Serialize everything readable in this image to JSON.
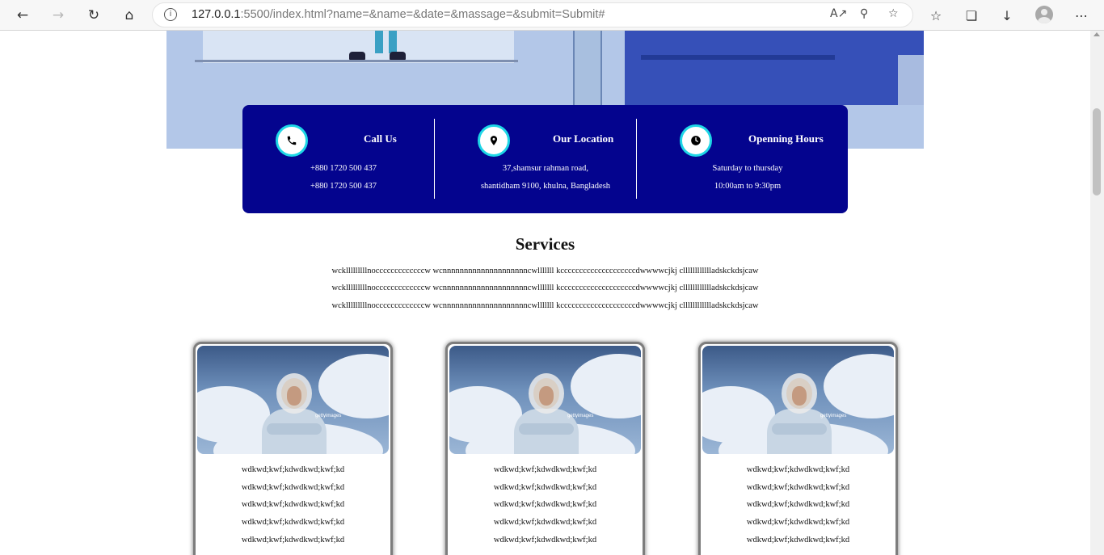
{
  "browser": {
    "url_host": "127.0.0.1",
    "url_rest": ":5500/index.html?name=&name=&date=&massage=&submit=Submit#",
    "icons": [
      "back-icon",
      "forward-icon",
      "refresh-icon",
      "home-icon",
      "info-icon",
      "read-aloud-icon",
      "zoom-icon",
      "add-favorite-icon",
      "favorites-icon",
      "collections-icon",
      "downloads-icon",
      "profile-icon",
      "more-icon"
    ]
  },
  "contact": {
    "call": {
      "title": "Call Us",
      "line1": "+880 1720 500 437",
      "line2": "+880 1720 500 437"
    },
    "location": {
      "title": "Our Location",
      "line1": "37,shamsur rahman road,",
      "line2": "shantidham 9100, khulna, Bangladesh"
    },
    "hours": {
      "title": "Openning Hours",
      "line1": "Saturday to thursday",
      "line2": "10:00am to 9:30pm"
    }
  },
  "services": {
    "title": "Services",
    "lines": [
      "wcklllllllllnocccccccccccccw wcnnnnnnnnnnnnnnnnnnnncwlllllll kccccccccccccccccccccdwwwwcjkj clllllllllllladskckdsjcaw",
      "wcklllllllllnocccccccccccccw wcnnnnnnnnnnnnnnnnnnnncwlllllll kccccccccccccccccccccdwwwwcjkj clllllllllllladskckdsjcaw",
      "wcklllllllllnocccccccccccccw wcnnnnnnnnnnnnnnnnnnnncwlllllll kccccccccccccccccccccdwwwwcjkj clllllllllllladskckdsjcaw"
    ]
  },
  "cards": [
    {
      "photo_watermark": "gettyimages",
      "lines": [
        "wdkwd;kwf;kdwdkwd;kwf;kd",
        "wdkwd;kwf;kdwdkwd;kwf;kd",
        "wdkwd;kwf;kdwdkwd;kwf;kd",
        "wdkwd;kwf;kdwdkwd;kwf;kd",
        "wdkwd;kwf;kdwdkwd;kwf;kd"
      ]
    },
    {
      "photo_watermark": "gettyimages",
      "lines": [
        "wdkwd;kwf;kdwdkwd;kwf;kd",
        "wdkwd;kwf;kdwdkwd;kwf;kd",
        "wdkwd;kwf;kdwdkwd;kwf;kd",
        "wdkwd;kwf;kdwdkwd;kwf;kd",
        "wdkwd;kwf;kdwdkwd;kwf;kd"
      ]
    },
    {
      "photo_watermark": "gettyimages",
      "lines": [
        "wdkwd;kwf;kdwdkwd;kwf;kd",
        "wdkwd;kwf;kdwdkwd;kwf;kd",
        "wdkwd;kwf;kdwdkwd;kwf;kd",
        "wdkwd;kwf;kdwdkwd;kwf;kd",
        "wdkwd;kwf;kdwdkwd;kwf;kd"
      ]
    }
  ],
  "colors": {
    "band": "#04048e",
    "accent_ring": "#1ed6e6",
    "hero_bg": "#b3c7e8"
  }
}
